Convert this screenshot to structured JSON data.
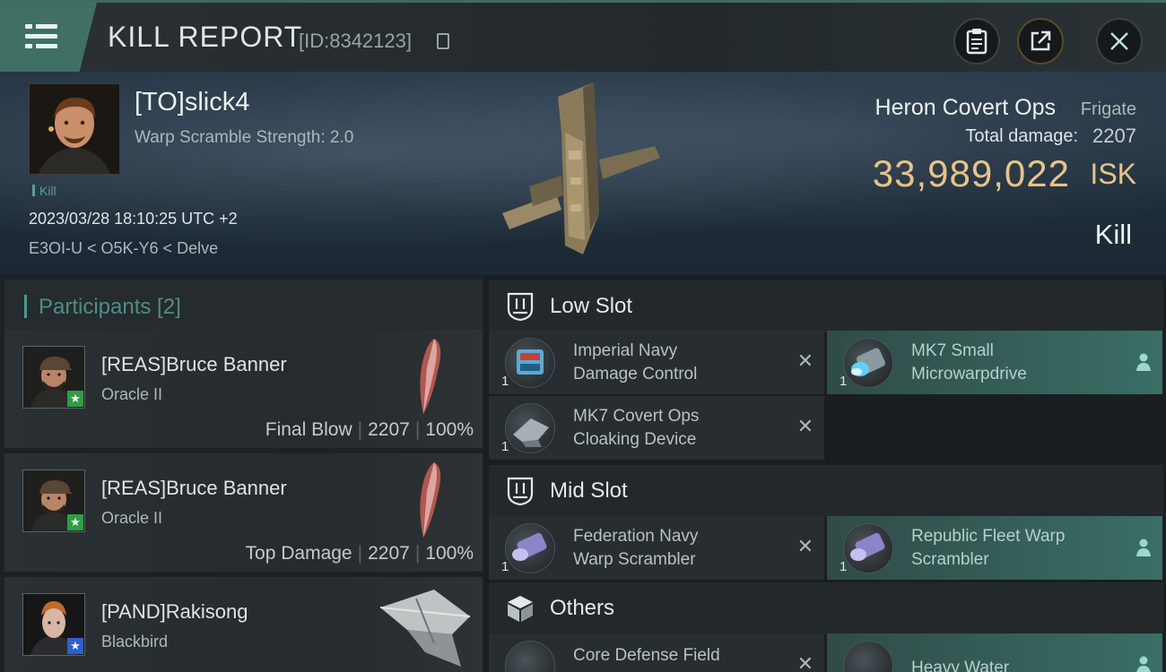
{
  "header": {
    "title": "KILL REPORT",
    "report_id": "[ID:8342123]"
  },
  "victim": {
    "name": "[TO]slick4",
    "warp_scramble_strength": "Warp Scramble Strength: 2.0",
    "tag": "Kill",
    "timestamp": "2023/03/28 18:10:25 UTC +2",
    "location": "E3OI-U < O5K-Y6 < Delve",
    "ship_name": "Heron Covert Ops",
    "ship_class": "Frigate",
    "total_damage_label": "Total damage:",
    "total_damage": "2207",
    "isk_value": "33,989,022",
    "isk_label": "ISK",
    "status": "Kill"
  },
  "participants": {
    "title": "Participants [2]",
    "items": [
      {
        "name": "[REAS]Bruce Banner",
        "ship": "Oracle II",
        "role": "Final Blow",
        "damage": "2207",
        "percent": "100%",
        "badge_color": "#2f9e45"
      },
      {
        "name": "[REAS]Bruce Banner",
        "ship": "Oracle II",
        "role": "Top Damage",
        "damage": "2207",
        "percent": "100%",
        "badge_color": "#2f9e45"
      },
      {
        "name": "[PAND]Rakisong",
        "ship": "Blackbird",
        "badge_color": "#2f5fd0"
      }
    ]
  },
  "slots": {
    "low": {
      "title": "Low Slot",
      "items": [
        {
          "name_line1": "Imperial Navy",
          "name_line2": "Damage Control",
          "qty": "1",
          "status": "destroyed"
        },
        {
          "name_line1": "MK7 Small",
          "name_line2": "Microwarpdrive",
          "qty": "1",
          "status": "dropped"
        },
        {
          "name_line1": "MK7 Covert Ops",
          "name_line2": "Cloaking Device",
          "qty": "1",
          "status": "destroyed"
        }
      ]
    },
    "mid": {
      "title": "Mid Slot",
      "items": [
        {
          "name_line1": "Federation Navy",
          "name_line2": "Warp Scrambler",
          "qty": "1",
          "status": "destroyed"
        },
        {
          "name_line1": "Republic Fleet Warp",
          "name_line2": "Scrambler",
          "qty": "1",
          "status": "dropped"
        }
      ]
    },
    "others": {
      "title": "Others",
      "items": [
        {
          "name_line1": "Core Defense Field",
          "name_line2": "",
          "qty": "",
          "status": "destroyed"
        },
        {
          "name_line1": "Heavy Water",
          "name_line2": "",
          "qty": "",
          "status": "dropped"
        }
      ]
    }
  },
  "colors": {
    "accent_teal": "#3f6f65",
    "isk_gold": "#e6c48a"
  },
  "icons": [
    "menu-icon",
    "copy-icon",
    "clipboard-icon",
    "share-icon",
    "close-icon",
    "low-slot-icon",
    "mid-slot-icon",
    "others-icon",
    "destroyed-x-icon",
    "dropped-person-icon"
  ]
}
